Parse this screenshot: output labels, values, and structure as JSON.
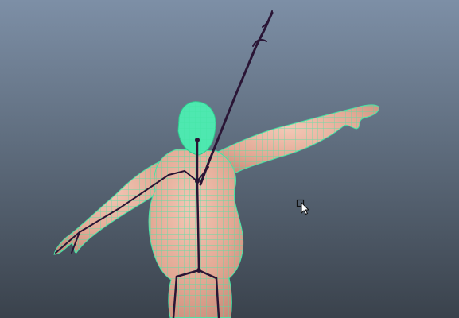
{
  "viewport": {
    "background_top": "#7d8fa6",
    "background_bottom": "#3a424c"
  },
  "model": {
    "skin_color": "#e9b3a0",
    "wireframe_color": "#45e6a6",
    "joint_color": "#2a1535",
    "selection_state": "selected"
  },
  "cursor": {
    "icon": "select-arrow-with-box-icon"
  }
}
